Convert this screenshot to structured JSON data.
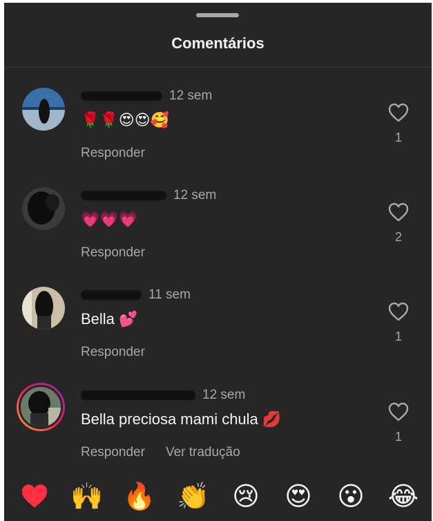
{
  "sheet": {
    "title": "Comentários"
  },
  "comments": [
    {
      "time": "12 sem",
      "text": "🌹🌹😍😍🥰",
      "reply_label": "Responder",
      "likes": "1"
    },
    {
      "time": "12 sem",
      "text": "💗💗💗",
      "reply_label": "Responder",
      "likes": "2"
    },
    {
      "time": "11 sem",
      "text": "Bella 💕",
      "reply_label": "Responder",
      "likes": "1"
    },
    {
      "time": "12 sem",
      "text": "Bella preciosa mami chula 💋",
      "reply_label": "Responder",
      "translate_label": "Ver tradução",
      "likes": "1"
    }
  ],
  "reactions": [
    "❤️",
    "🙌",
    "🔥",
    "👏",
    "😢",
    "😍",
    "😮",
    "😂"
  ],
  "colors": {
    "background": "#262626",
    "text": "#f5f5f5",
    "secondary_text": "#a8a8a8",
    "heart_red": "#ff3040"
  }
}
